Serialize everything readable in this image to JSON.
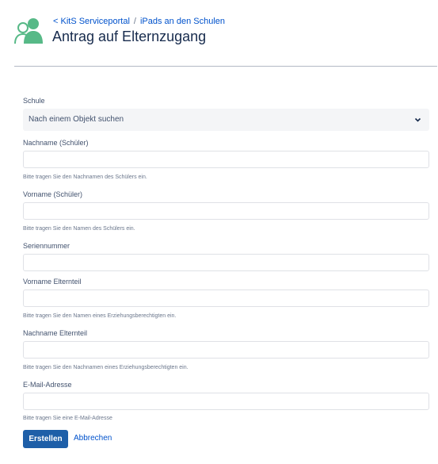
{
  "header": {
    "breadcrumb": {
      "portal": "< KitS Serviceportal",
      "separator": "/",
      "project": "iPads an den Schulen"
    },
    "title": "Antrag auf Elternzugang",
    "logo_icon": "users-icon",
    "logo_color": "#57b987"
  },
  "form": {
    "schule": {
      "label": "Schule",
      "placeholder": "Nach einem Objekt suchen",
      "icon": "chevron-down-icon"
    },
    "nachname_schueler": {
      "label": "Nachname (Schüler)",
      "value": "",
      "help": "Bitte tragen Sie den Nachnamen des Schülers ein."
    },
    "vorname_schueler": {
      "label": "Vorname (Schüler)",
      "value": "",
      "help": "Bitte tragen Sie den Namen des Schülers ein."
    },
    "seriennummer": {
      "label": "Seriennummer",
      "value": ""
    },
    "vorname_elternteil": {
      "label": "Vorname Elternteil",
      "value": "",
      "help": "Bitte tragen Sie den Namen eines Erziehungsberechtigten ein."
    },
    "nachname_elternteil": {
      "label": "Nachname Elternteil",
      "value": "",
      "help": "Bitte tragen Sie den Nachnamen eines Erziehungsberechtigten ein."
    },
    "email": {
      "label": "E-Mail-Adresse",
      "value": "",
      "help": "Bitte tragen Sie eine E-Mail-Adresse"
    },
    "submit_label": "Erstellen",
    "cancel_label": "Abbrechen"
  },
  "colors": {
    "accent": "#0052cc",
    "primary_button": "#1e5fa8",
    "logo": "#57b987"
  }
}
